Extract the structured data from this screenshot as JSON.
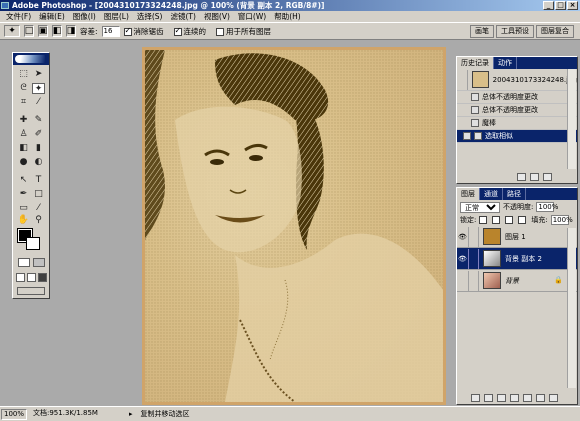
{
  "window": {
    "title": "Adobe Photoshop - [2004310173324248.jpg @ 100% (背景 副本 2, RGB/8#)]",
    "minimize": "_",
    "maximize": "□",
    "close": "×"
  },
  "menu": [
    "文件(F)",
    "编辑(E)",
    "图像(I)",
    "图层(L)",
    "选择(S)",
    "滤镜(T)",
    "视图(V)",
    "窗口(W)",
    "帮助(H)"
  ],
  "options": {
    "tolerance_label": "容差:",
    "tolerance_value": "16",
    "antialias": {
      "label": "消除锯齿",
      "checked": true
    },
    "contiguous": {
      "label": "连续的",
      "checked": true
    },
    "all_layers": {
      "label": "用于所有图层",
      "checked": false
    }
  },
  "workspace_tabs": [
    "画笔",
    "工具预设",
    "图层复合"
  ],
  "history": {
    "tabs": [
      "历史记录",
      "动作"
    ],
    "snapshot": "2004310173324248.jpg",
    "items": [
      {
        "label": "总体不透明度更改",
        "selected": false
      },
      {
        "label": "总体不透明度更改",
        "selected": false
      },
      {
        "label": "魔棒",
        "selected": false
      },
      {
        "label": "选取相似",
        "selected": true
      }
    ]
  },
  "layers": {
    "tabs": [
      "图层",
      "通道",
      "路径"
    ],
    "blend_mode": "正常",
    "opacity_label": "不透明度:",
    "opacity_value": "100%",
    "lock_label": "锁定:",
    "fill_label": "填充:",
    "fill_value": "100%",
    "items": [
      {
        "name": "图层 1",
        "visible": true,
        "selected": false,
        "thumb": "#b9842c"
      },
      {
        "name": "背景 副本 2",
        "visible": true,
        "selected": true,
        "thumb": "#c8c8c8"
      },
      {
        "name": "背景",
        "visible": false,
        "selected": false,
        "thumb": "#e0b0a0",
        "locked": true
      }
    ]
  },
  "status": {
    "zoom": "100%",
    "doc": "文档:951.3K/1.85M",
    "hint": "复制并移动选区"
  },
  "colors": {
    "canvas": "#d9bf89",
    "hair": "#5a4410",
    "titlebar": "#0a246a",
    "workspace": "#aaaaaa"
  }
}
